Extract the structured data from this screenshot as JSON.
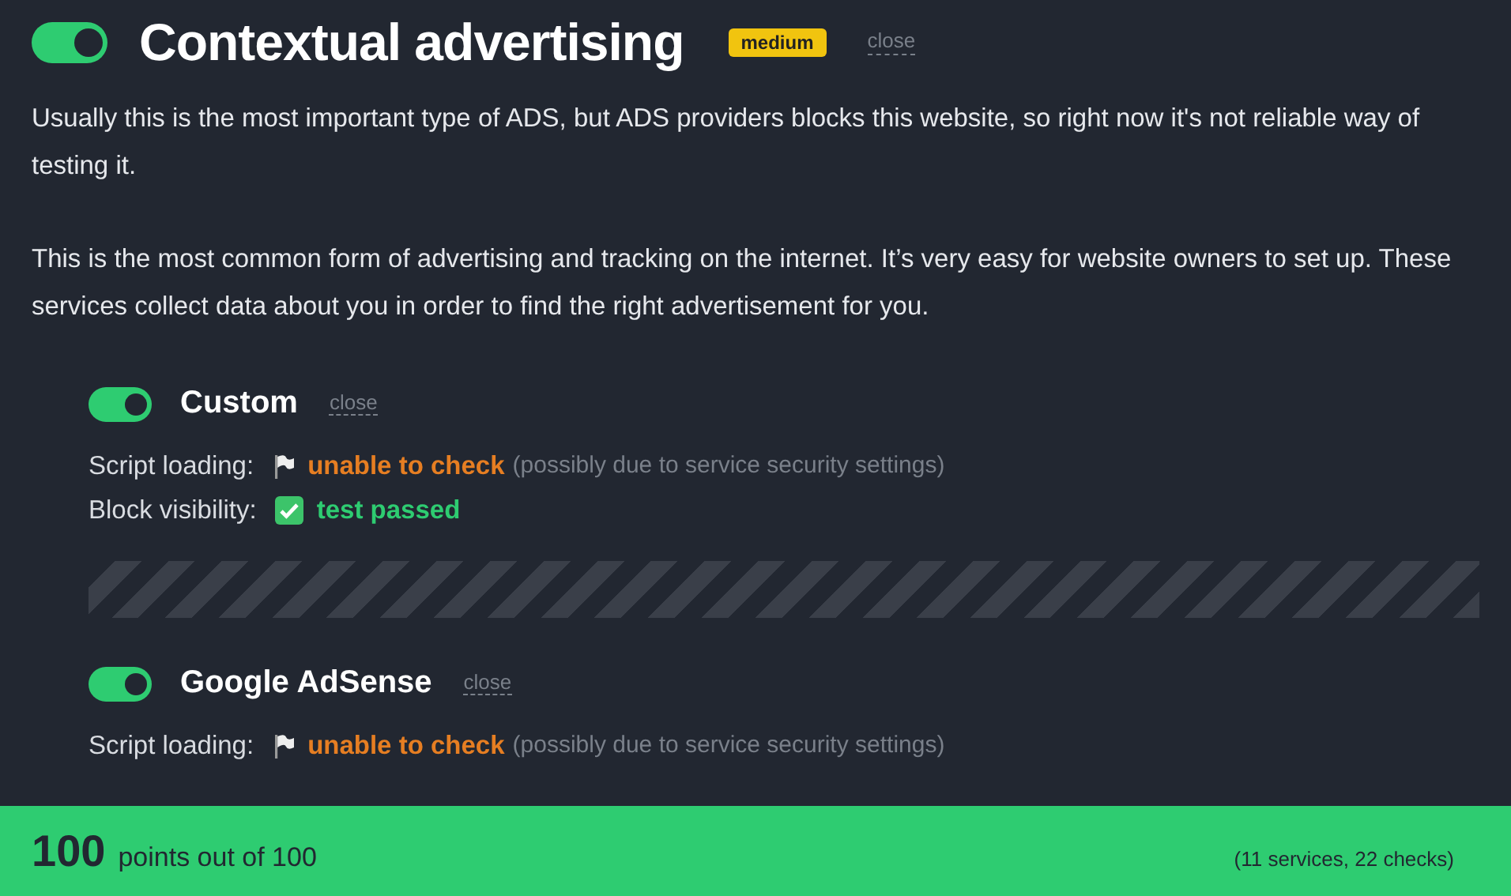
{
  "category": {
    "title": "Contextual advertising",
    "on": true,
    "badge": "medium",
    "close": "close",
    "paragraphs": [
      "Usually this is the most important type of ADS, but ADS providers blocks this website, so right now it's not reliable way of testing it.",
      "This is the most common form of advertising and tracking on the internet. It’s very easy for website owners to set up. These services collect data about you in order to find the right advertisement for you."
    ]
  },
  "services": [
    {
      "name": "Custom",
      "on": true,
      "close": "close",
      "placeholder": true,
      "checks": [
        {
          "label": "Script loading:",
          "kind": "warning",
          "result": "unable to check",
          "note": "(possibly due to service security settings)"
        },
        {
          "label": "Block visibility:",
          "kind": "passed",
          "result": "test passed"
        }
      ]
    },
    {
      "name": "Google AdSense",
      "on": true,
      "close": "close",
      "placeholder": false,
      "checks": [
        {
          "label": "Script loading:",
          "kind": "warning",
          "result": "unable to check",
          "note": "(possibly due to service security settings)"
        }
      ]
    }
  ],
  "footer": {
    "score": "100",
    "text": "points out of 100",
    "summary": "(11 services, 22 checks)"
  }
}
